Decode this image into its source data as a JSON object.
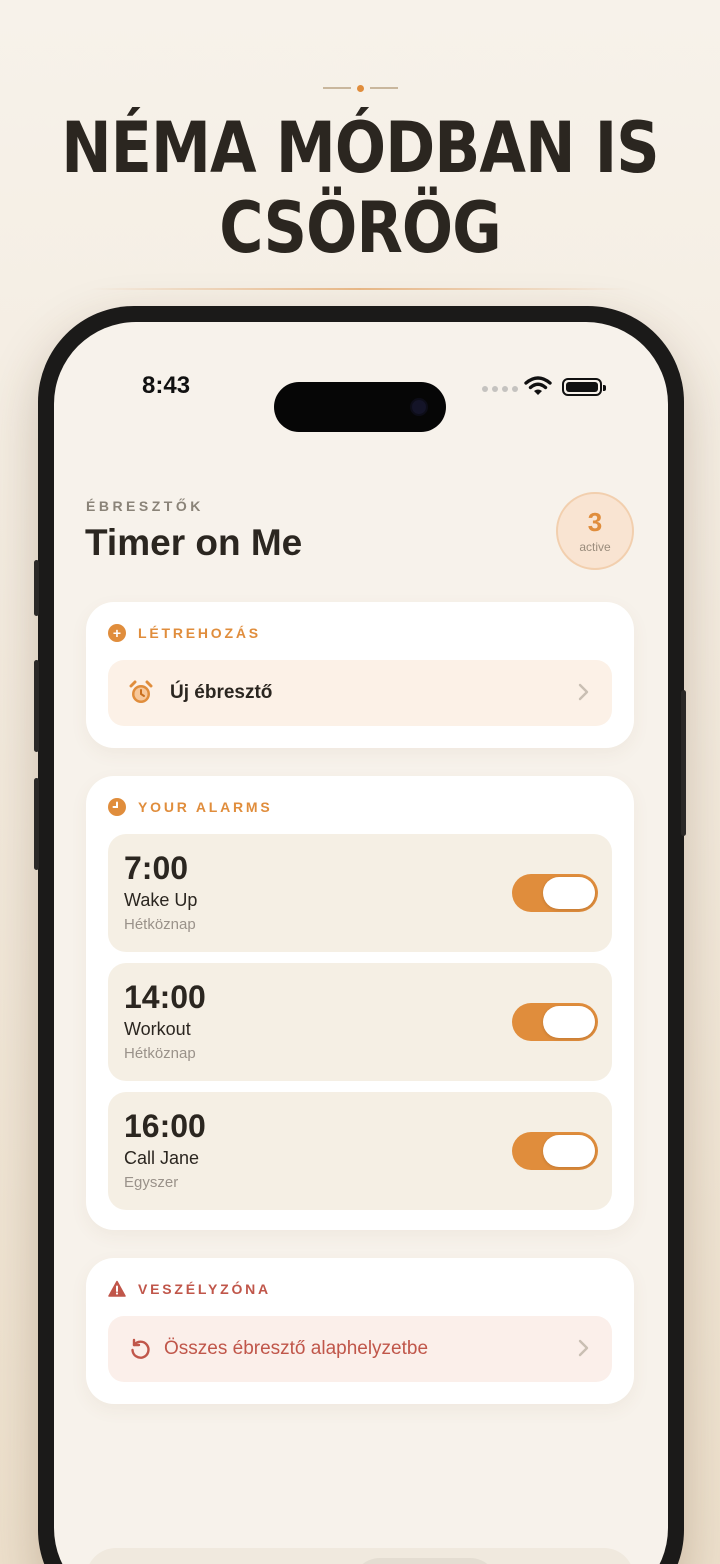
{
  "headline": {
    "line1": "NÉMA MÓDBAN IS",
    "line2": "CSÖRÖG"
  },
  "status_bar": {
    "time": "8:43"
  },
  "header": {
    "subtitle": "ÉBRESZTŐK",
    "title": "Timer on Me",
    "badge_count": "3",
    "badge_label": "active"
  },
  "create_section": {
    "title": "LÉTREHOZÁS",
    "new_alarm_label": "Új ébresztő"
  },
  "alarms_section": {
    "title": "YOUR ALARMS",
    "alarms": [
      {
        "time": "7:00",
        "name": "Wake Up",
        "repeat": "Hétköznap",
        "enabled": true
      },
      {
        "time": "14:00",
        "name": "Workout",
        "repeat": "Hétköznap",
        "enabled": true
      },
      {
        "time": "16:00",
        "name": "Call Jane",
        "repeat": "Egyszer",
        "enabled": true
      }
    ]
  },
  "danger_section": {
    "title": "VESZÉLYZÓNA",
    "reset_label": "Összes ébresztő alaphelyzetbe"
  },
  "tab_bar": {
    "tabs": [
      {
        "icon": "stopwatch-icon",
        "active": false
      },
      {
        "icon": "timer-icon",
        "active": false
      },
      {
        "icon": "alarm-clock-icon",
        "active": true
      },
      {
        "icon": "gear-icon",
        "active": false
      }
    ]
  },
  "colors": {
    "accent": "#e08d3c",
    "danger": "#c0564a",
    "background": "#f7f2eb",
    "active_tab": "#2f86e8"
  }
}
